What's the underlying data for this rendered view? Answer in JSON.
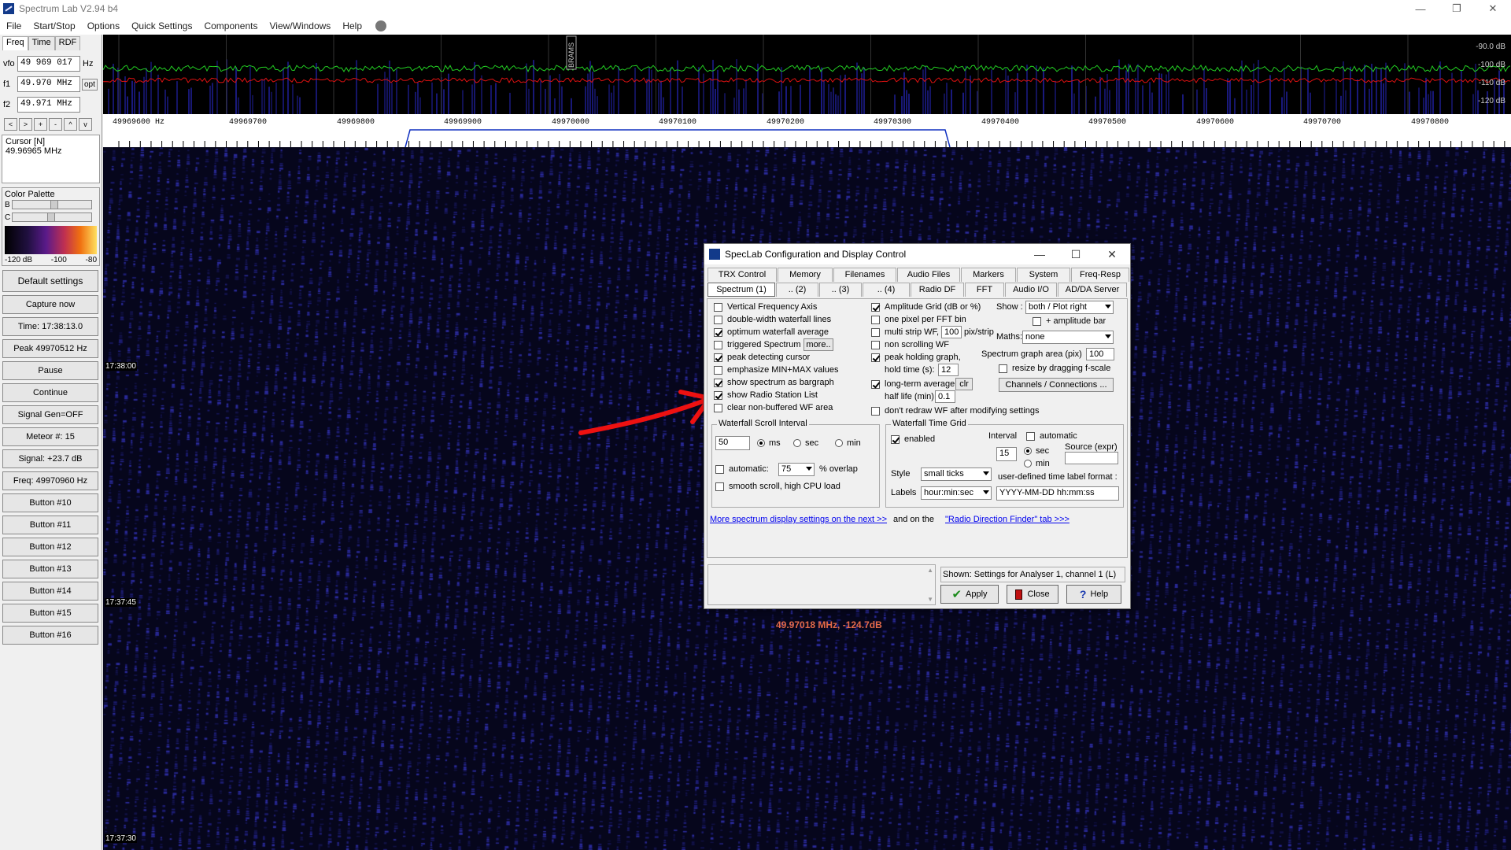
{
  "window": {
    "title": "Spectrum Lab V2.94 b4",
    "minimize": "—",
    "restore": "❐",
    "close": "✕"
  },
  "menu": [
    "File",
    "Start/Stop",
    "Options",
    "Quick Settings",
    "Components",
    "View/Windows",
    "Help"
  ],
  "left": {
    "tabs": [
      "Freq",
      "Time",
      "RDF"
    ],
    "vfo_label": "vfo",
    "vfo_value": "49 969 017",
    "vfo_unit": "Hz",
    "f1_label": "f1",
    "f1_value": "49.970 MHz",
    "f1_unit": "opt",
    "f2_label": "f2",
    "f2_value": "49.971 MHz",
    "arrows": [
      "<",
      ">",
      "+",
      "-",
      "^",
      "v"
    ],
    "cursor_title": "Cursor [N]",
    "cursor_value": "49.96965 MHz",
    "palette_title": "Color Palette",
    "palette_b": "B",
    "palette_c": "C",
    "palette_labels": [
      "-120 dB",
      "-100",
      "-80"
    ],
    "buttons": [
      "Default settings",
      "Capture now",
      "Time:  17:38:13.0",
      "Peak 49970512 Hz",
      "Pause",
      "Continue",
      "Signal Gen=OFF",
      "Meteor #: 15",
      "Signal: +23.7 dB",
      "Freq: 49970960 Hz",
      "Button #10",
      "Button #11",
      "Button #12",
      "Button #13",
      "Button #14",
      "Button #15",
      "Button #16"
    ]
  },
  "spectrum": {
    "db_labels": [
      "-90.0 dB",
      "-100 dB",
      "-110 dB",
      "-120 dB"
    ],
    "marker": "BRAMS",
    "colors": {
      "bg": "#000000",
      "green": "#22cc22",
      "red": "#dd1111",
      "bars": "#1a1a80"
    }
  },
  "freqscale": {
    "labels": [
      "49969600 Hz",
      "49969700",
      "49969800",
      "49969900",
      "49970000",
      "49970100",
      "49970200",
      "49970300",
      "49970400",
      "49970500",
      "49970600",
      "49970700",
      "49970800"
    ]
  },
  "waterfall": {
    "times": [
      "17:38:00",
      "17:37:45",
      "17:37:30"
    ],
    "readout": "49.97018 MHz, -124.7dB"
  },
  "dialog": {
    "title": "SpecLab  Configuration and Display Control",
    "tabs_row1": [
      "TRX Control",
      "Memory",
      "Filenames",
      "Audio Files",
      "Markers",
      "System",
      "Freq-Resp"
    ],
    "tabs_row2": [
      "Spectrum (1)",
      ".. (2)",
      ".. (3)",
      ".. (4)",
      "Radio DF",
      "FFT",
      "Audio I/O",
      "AD/DA Server"
    ],
    "left_checks": [
      {
        "label": "Vertical Frequency Axis",
        "on": false
      },
      {
        "label": "double-width waterfall lines",
        "on": false
      },
      {
        "label": "optimum waterfall average",
        "on": true
      },
      {
        "label": "triggered Spectrum",
        "on": false
      },
      {
        "label": "peak detecting cursor",
        "on": true
      },
      {
        "label": "emphasize MIN+MAX values",
        "on": false
      },
      {
        "label": "show spectrum as bargraph",
        "on": true
      },
      {
        "label": "show Radio Station List",
        "on": true
      },
      {
        "label": "clear non-buffered WF area",
        "on": false
      }
    ],
    "more_btn": "more..",
    "mid_checks": {
      "amp_grid": "Amplitude Grid (dB or %)",
      "one_pixel": "one pixel per FFT bin",
      "multi_strip": "multi strip WF,",
      "multi_strip_val": "100",
      "pix_strip": "pix/strip",
      "non_scroll": "non scrolling WF",
      "peak_hold": "peak holding graph,",
      "hold_time": "hold time (s):",
      "hold_val": "12",
      "long_term": "long-term average",
      "clr": "clr",
      "half_life": "half life (min):",
      "half_val": "0.1",
      "dont_redraw": "don't redraw WF after modifying settings"
    },
    "right": {
      "show_label": "Show :",
      "show_value": "both / Plot  right",
      "amp_bar": "+ amplitude bar",
      "maths_label": "Maths:",
      "maths_value": "none",
      "graph_area_label": "Spectrum graph area (pix)",
      "graph_area_value": "100",
      "resize": "resize by dragging f-scale",
      "channels_btn": "Channels / Connections ..."
    },
    "scroll": {
      "title": "Waterfall Scroll Interval",
      "value": "50",
      "ms": "ms",
      "sec": "sec",
      "min": "min",
      "automatic": "automatic:",
      "overlap_val": "75",
      "overlap": "% overlap",
      "smooth": "smooth scroll, high CPU load"
    },
    "tgrid": {
      "title": "Waterfall Time Grid",
      "enabled": "enabled",
      "interval": "Interval",
      "automatic": "automatic",
      "interval_val": "15",
      "sec": "sec",
      "min": "min",
      "source": "Source (expr)",
      "style_label": "Style",
      "style_value": "small ticks",
      "labels_label": "Labels",
      "labels_value": "hour:min:sec",
      "udf": "user-defined time label format :",
      "udf_value": "YYYY-MM-DD hh:mm:ss"
    },
    "links": {
      "more": "More spectrum display settings on the next >>",
      "and": "and on the",
      "rdf": "\"Radio Direction Finder\" tab    >>>"
    },
    "footer": {
      "shown": "Shown: Settings for Analyser 1, channel 1 (L)",
      "apply": "Apply",
      "close": "Close",
      "help": "Help"
    }
  }
}
